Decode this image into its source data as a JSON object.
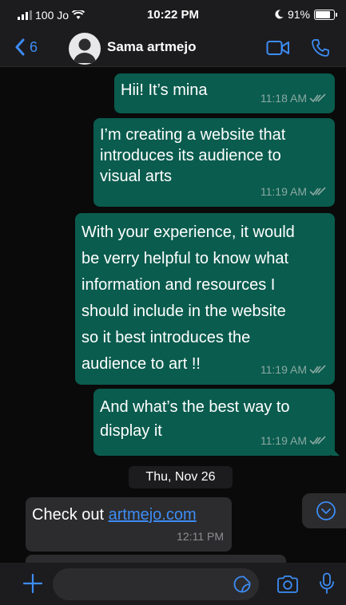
{
  "status_bar": {
    "carrier": "100 Jo",
    "time": "10:22 PM",
    "battery_percent": "91%",
    "battery_level": 0.91
  },
  "header": {
    "back_count": "6",
    "contact_name": "Sama artmejo",
    "icons": [
      "chevron-left-icon",
      "avatar",
      "video-camera-icon",
      "phone-icon"
    ]
  },
  "messages": [
    {
      "direction": "out",
      "text": "Hii! It’s mina",
      "time": "11:18 AM",
      "status": "read"
    },
    {
      "direction": "out",
      "text": "I’m creating a website that\nintroduces its audience to\nvisual arts",
      "time": "11:19 AM",
      "status": "read"
    },
    {
      "direction": "out",
      "text": "With your experience, it would\nbe verry helpful to know what\ninformation and resources I\nshould include in the website\nso it best introduces the\naudience to art !!",
      "time": "11:19 AM",
      "status": "read"
    },
    {
      "direction": "out",
      "text": "And what’s the best way to\ndisplay it",
      "time": "11:19 AM",
      "status": "read"
    },
    {
      "direction": "in",
      "prefix": "Check out ",
      "link": "artmejo.com",
      "time": "12:11 PM"
    }
  ],
  "date_separator": "Thu, Nov 26",
  "input_bar": {
    "placeholder": "",
    "icons": [
      "plus-icon",
      "sticker-icon",
      "camera-icon",
      "microphone-icon"
    ]
  },
  "colors": {
    "outgoing_bubble": "#0a5c4e",
    "incoming_bubble": "#2c2c2e",
    "accent": "#3d8cf5",
    "background": "#000000"
  }
}
